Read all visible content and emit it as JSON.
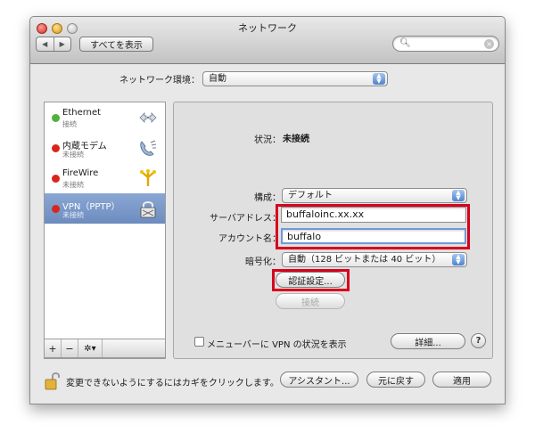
{
  "window": {
    "title": "ネットワーク"
  },
  "toolbar": {
    "back": "◀",
    "forward": "▶",
    "show_all": "すべてを表示",
    "search_icon": "magnifier-icon",
    "clear_icon": "clear-icon"
  },
  "location": {
    "label": "ネットワーク環境：",
    "value": "自動"
  },
  "services": [
    {
      "name": "Ethernet",
      "status": "接続",
      "dot_color": "#4fb33a",
      "icon": "ethernet-arrows-icon"
    },
    {
      "name": "内蔵モデム",
      "status": "未接続",
      "dot_color": "#d8261c",
      "icon": "phone-modem-icon"
    },
    {
      "name": "FireWire",
      "status": "未接続",
      "dot_color": "#d8261c",
      "icon": "firewire-icon"
    },
    {
      "name": "VPN（PPTP）",
      "status": "未接続",
      "dot_color": "#d8261c",
      "icon": "lock-vpn-icon"
    }
  ],
  "sidebar_toolbar": {
    "add": "+",
    "remove": "−",
    "action": "✲▾"
  },
  "detail": {
    "status_label": "状況：",
    "status_value": "未接続",
    "config_label": "構成：",
    "config_value": "デフォルト",
    "server_label": "サーバアドレス：",
    "server_value": "buffaloinc.xx.xx",
    "account_label": "アカウント名：",
    "account_value": "buffalo",
    "encryption_label": "暗号化：",
    "encryption_value": "自動（128 ビットまたは 40 ビット）",
    "auth_button": "認証設定...",
    "connect_button": "接続"
  },
  "footer": {
    "menu_checkbox_label": "メニューバーに VPN の状況を表示",
    "advanced_button": "詳細...",
    "help": "?",
    "lock_text": "変更できないようにするにはカギをクリックします。",
    "assistant_button": "アシスタント...",
    "revert_button": "元に戻す",
    "apply_button": "適用"
  },
  "colors": {
    "highlight_box": "#d8001c",
    "selection": "#6d8cbf"
  }
}
